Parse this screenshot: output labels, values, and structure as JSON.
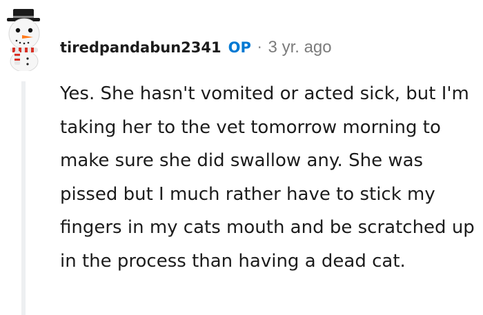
{
  "comment": {
    "author": "tiredpandabun2341",
    "op_badge": "OP",
    "separator": "·",
    "timestamp": "3 yr. ago",
    "avatar_icon": "snowman-avatar-icon",
    "body": "Yes. She hasn't vomited or acted sick, but I'm taking her to the vet tomorrow morning to make sure she did swallow any. She was pissed but I much rather have to stick my fingers in my cats mouth and be scratched up in the process than having a dead cat."
  },
  "colors": {
    "text": "#1c1c1c",
    "op_badge": "#0079d3",
    "meta_gray": "#7c7c7c",
    "thread_line": "#edeff1",
    "background": "#ffffff"
  }
}
